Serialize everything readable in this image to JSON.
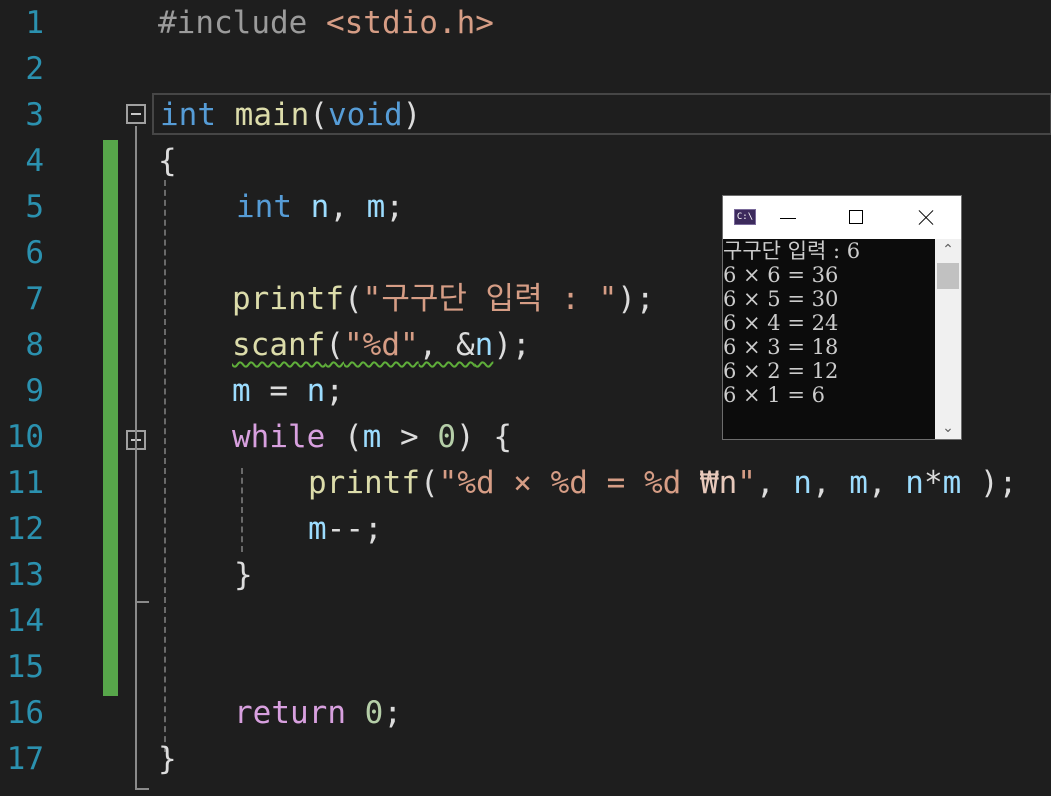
{
  "editor": {
    "line_numbers": [
      "1",
      "2",
      "3",
      "4",
      "5",
      "6",
      "7",
      "8",
      "9",
      "10",
      "11",
      "12",
      "13",
      "14",
      "15",
      "16",
      "17"
    ],
    "lines": {
      "l1": {
        "directive": "#include",
        "header": "<stdio.h>"
      },
      "l3": {
        "ret_type": "int",
        "func": "main",
        "open": "(",
        "param": "void",
        "close": ")"
      },
      "l4": {
        "text": "{"
      },
      "l5": {
        "type": "int",
        "v1": "n",
        "sep": ", ",
        "v2": "m",
        "end": ";"
      },
      "l7": {
        "func": "printf",
        "open": "(",
        "str": "\"구구단 입력 : \"",
        "end": ");"
      },
      "l8": {
        "func": "scanf",
        "open": "(",
        "str": "\"%d\"",
        "sep": ", &",
        "var": "n",
        "end": ");"
      },
      "l9": {
        "lhs": "m",
        "op": " = ",
        "rhs": "n",
        "end": ";"
      },
      "l10": {
        "kw": "while",
        "open": " (",
        "var": "m",
        "op": " > ",
        "num": "0",
        "end": ") {"
      },
      "l11": {
        "func": "printf",
        "open": "(",
        "str1": "\"%d × %d = %d ",
        "esc": "₩n",
        "str2": "\"",
        "sep1": ", ",
        "a1": "n",
        "sep2": ", ",
        "a2": "m",
        "sep3": ", ",
        "a3n": "n",
        "star": "*",
        "a3m": "m",
        "end": " );"
      },
      "l12": {
        "var": "m",
        "end": "--;"
      },
      "l13": {
        "text": "}"
      },
      "l16": {
        "kw": "return",
        "num": "0",
        "end": ";"
      },
      "l17": {
        "text": "}"
      }
    }
  },
  "console": {
    "icon_text": "C:\\",
    "lines": [
      "구구단 입력 : 6",
      "6 × 6 = 36",
      "6 × 5 = 30",
      "6 × 4 = 24",
      "6 × 3 = 18",
      "6 × 2 = 12",
      "6 × 1 = 6"
    ]
  },
  "colors": {
    "background": "#1e1e1e",
    "line_number": "#2b91af",
    "keyword": "#569cd6",
    "control_keyword": "#d8a0df",
    "function": "#dcdcaa",
    "variable": "#9cdcfe",
    "string": "#d69d85",
    "number": "#b5cea8",
    "change_bar": "#57a64a"
  }
}
